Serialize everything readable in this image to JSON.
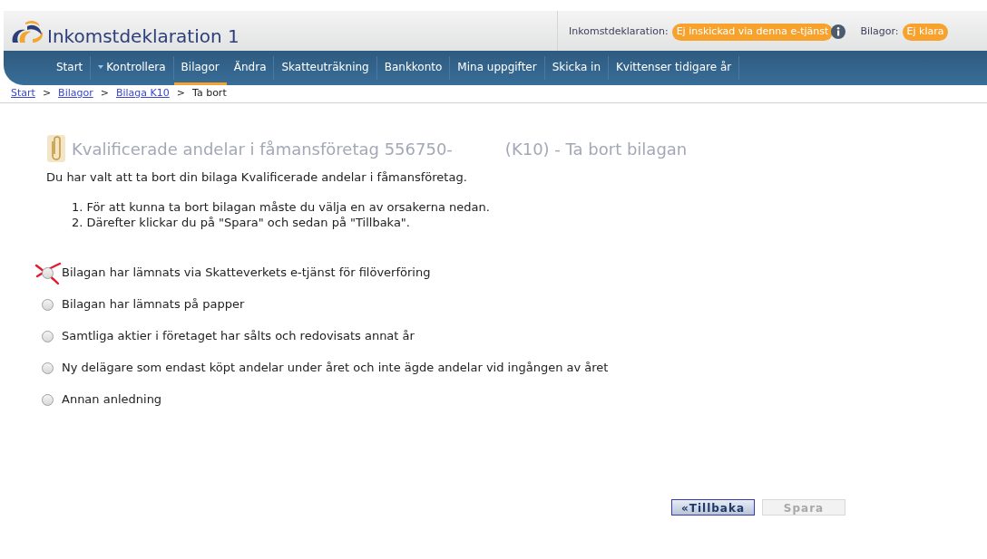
{
  "header": {
    "title": "Inkomstdeklaration 1",
    "status": [
      {
        "label": "Inkomstdeklaration:",
        "badge": "Ej inskickad via denna e-tjänst",
        "info": true
      },
      {
        "label": "Bilagor:",
        "badge": "Ej klara",
        "info": false
      }
    ]
  },
  "nav": [
    {
      "label": "Start",
      "selected": false,
      "dropdown": false
    },
    {
      "label": "Kontrollera",
      "selected": false,
      "dropdown": true
    },
    {
      "label": "Bilagor",
      "selected": true,
      "dropdown": false
    },
    {
      "label": "Ändra",
      "selected": false,
      "dropdown": false
    },
    {
      "label": "Skatteuträkning",
      "selected": false,
      "dropdown": false
    },
    {
      "label": "Bankkonto",
      "selected": false,
      "dropdown": false
    },
    {
      "label": "Mina uppgifter",
      "selected": false,
      "dropdown": false
    },
    {
      "label": "Skicka in",
      "selected": false,
      "dropdown": false
    },
    {
      "label": "Kvittenser tidigare år",
      "selected": false,
      "dropdown": false
    }
  ],
  "breadcrumb": [
    {
      "label": "Start",
      "link": true,
      "separator": ">"
    },
    {
      "label": "Bilagor",
      "link": true,
      "separator": ">"
    },
    {
      "label": "Bilaga K10",
      "link": true,
      "separator": ">"
    },
    {
      "label": "Ta bort",
      "link": false
    }
  ],
  "page_title": {
    "main": "Kvalificerade andelar i fåmansföretag 556750-",
    "suffix": "(K10) - Ta bort bilagan"
  },
  "intro": "Du har valt att ta bort din bilaga Kvalificerade andelar i fåmansföretag.",
  "steps": [
    {
      "number": "1.",
      "text": "För att kunna ta bort bilagan måste du välja en av orsakerna nedan."
    },
    {
      "number": "2.",
      "text": "Därefter klickar du på \"Spara\" och sedan på \"Tillbaka\"."
    }
  ],
  "reasons": [
    {
      "label": "Bilagan har lämnats via Skatteverkets e-tjänst för filöverföring",
      "selected": false,
      "crossed": true
    },
    {
      "label": "Bilagan har lämnats på papper",
      "selected": false,
      "crossed": false
    },
    {
      "label": "Samtliga aktier i företaget har sålts och redovisats annat år",
      "selected": false,
      "crossed": false
    },
    {
      "label": "Ny delägare som endast köpt andelar under året och inte ägde andelar vid ingången av året",
      "selected": false,
      "crossed": false
    },
    {
      "label": "Annan anledning",
      "selected": false,
      "crossed": false
    }
  ],
  "buttons": [
    {
      "label": "«Tillbaka",
      "disabled": false
    },
    {
      "label": "Spara",
      "disabled": true
    }
  ]
}
